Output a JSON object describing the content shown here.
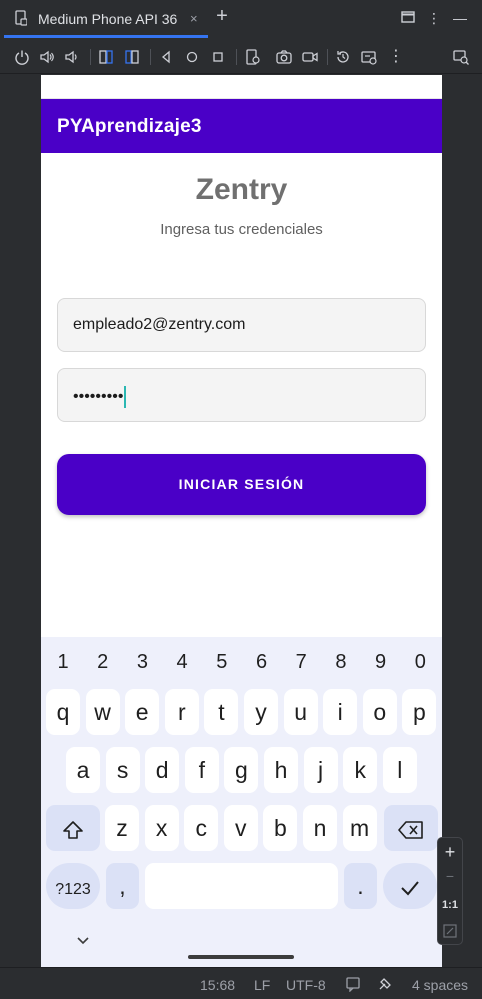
{
  "ide": {
    "tab_label": "Medium Phone API 36",
    "tab_close": "×",
    "new_tab": "+"
  },
  "toolbar": {
    "icons": [
      "power-icon",
      "volume-up-icon",
      "volume-down-icon",
      "rotate-left-icon",
      "rotate-right-icon",
      "back-icon",
      "home-icon",
      "overview-icon",
      "fold-icon",
      "screenshot-icon",
      "screen-record-icon",
      "snapshot-icon",
      "extended-controls-icon",
      "more-icon",
      "device-mirror-icon"
    ]
  },
  "app": {
    "title": "PYAprendizaje3",
    "brand": "Zentry",
    "subtitle": "Ingresa tus credenciales",
    "email_value": "empleado2@zentry.com",
    "password_value": "•••••••••",
    "login_label": "INICIAR SESIÓN",
    "primary_color": "#4a00c7"
  },
  "keyboard": {
    "numbers": [
      "1",
      "2",
      "3",
      "4",
      "5",
      "6",
      "7",
      "8",
      "9",
      "0"
    ],
    "row1": [
      "q",
      "w",
      "e",
      "r",
      "t",
      "y",
      "u",
      "i",
      "o",
      "p"
    ],
    "row2": [
      "a",
      "s",
      "d",
      "f",
      "g",
      "h",
      "j",
      "k",
      "l"
    ],
    "row3": [
      "z",
      "x",
      "c",
      "v",
      "b",
      "n",
      "m"
    ],
    "symbols_key": "?123",
    "comma_key": ",",
    "period_key": "."
  },
  "zoom": {
    "plus": "+",
    "minus": "−",
    "ratio": "1:1"
  },
  "statusbar": {
    "position": "15:68",
    "line_ending": "LF",
    "encoding": "UTF-8",
    "indent": "4 spaces"
  }
}
